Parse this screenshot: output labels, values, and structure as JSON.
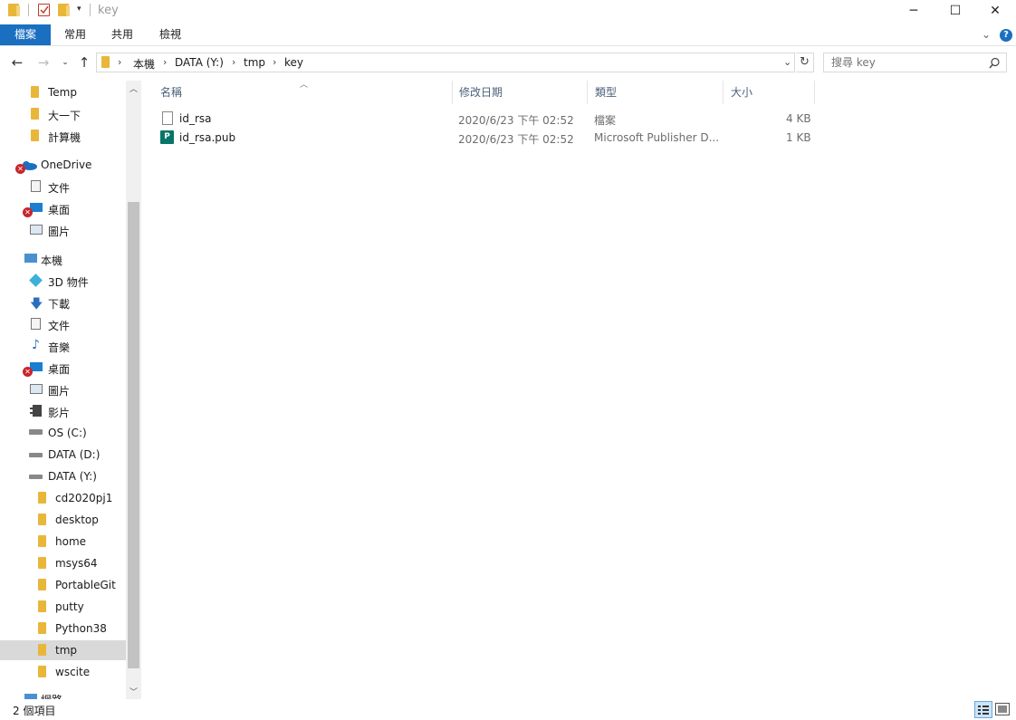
{
  "window": {
    "title": "key"
  },
  "ribbon": {
    "tabs": [
      "檔案",
      "常用",
      "共用",
      "檢視"
    ]
  },
  "address": {
    "crumbs": [
      "本機",
      "DATA (Y:)",
      "tmp",
      "key"
    ]
  },
  "search": {
    "placeholder": "搜尋 key"
  },
  "nav": {
    "items": [
      {
        "label": "Temp"
      },
      {
        "label": "大一下"
      },
      {
        "label": "計算機"
      },
      {
        "label": "OneDrive"
      },
      {
        "label": "文件"
      },
      {
        "label": "桌面"
      },
      {
        "label": "圖片"
      },
      {
        "label": "本機"
      },
      {
        "label": "3D 物件"
      },
      {
        "label": "下載"
      },
      {
        "label": "文件"
      },
      {
        "label": "音樂"
      },
      {
        "label": "桌面"
      },
      {
        "label": "圖片"
      },
      {
        "label": "影片"
      },
      {
        "label": "OS (C:)"
      },
      {
        "label": "DATA (D:)"
      },
      {
        "label": "DATA (Y:)"
      },
      {
        "label": "cd2020pj1"
      },
      {
        "label": "desktop"
      },
      {
        "label": "home"
      },
      {
        "label": "msys64"
      },
      {
        "label": "PortableGit"
      },
      {
        "label": "putty"
      },
      {
        "label": "Python38"
      },
      {
        "label": "tmp"
      },
      {
        "label": "wscite"
      },
      {
        "label": "網路"
      }
    ]
  },
  "columns": [
    "名稱",
    "修改日期",
    "類型",
    "大小"
  ],
  "files": [
    {
      "name": "id_rsa",
      "date": "2020/6/23 下午 02:52",
      "type": "檔案",
      "size": "4 KB"
    },
    {
      "name": "id_rsa.pub",
      "date": "2020/6/23 下午 02:52",
      "type": "Microsoft Publisher D...",
      "size": "1 KB"
    }
  ],
  "status": {
    "count": "2 個項目"
  },
  "colors": {
    "accent": "#1a6fc0",
    "folder": "#e8b73a",
    "error": "#c8252c"
  }
}
